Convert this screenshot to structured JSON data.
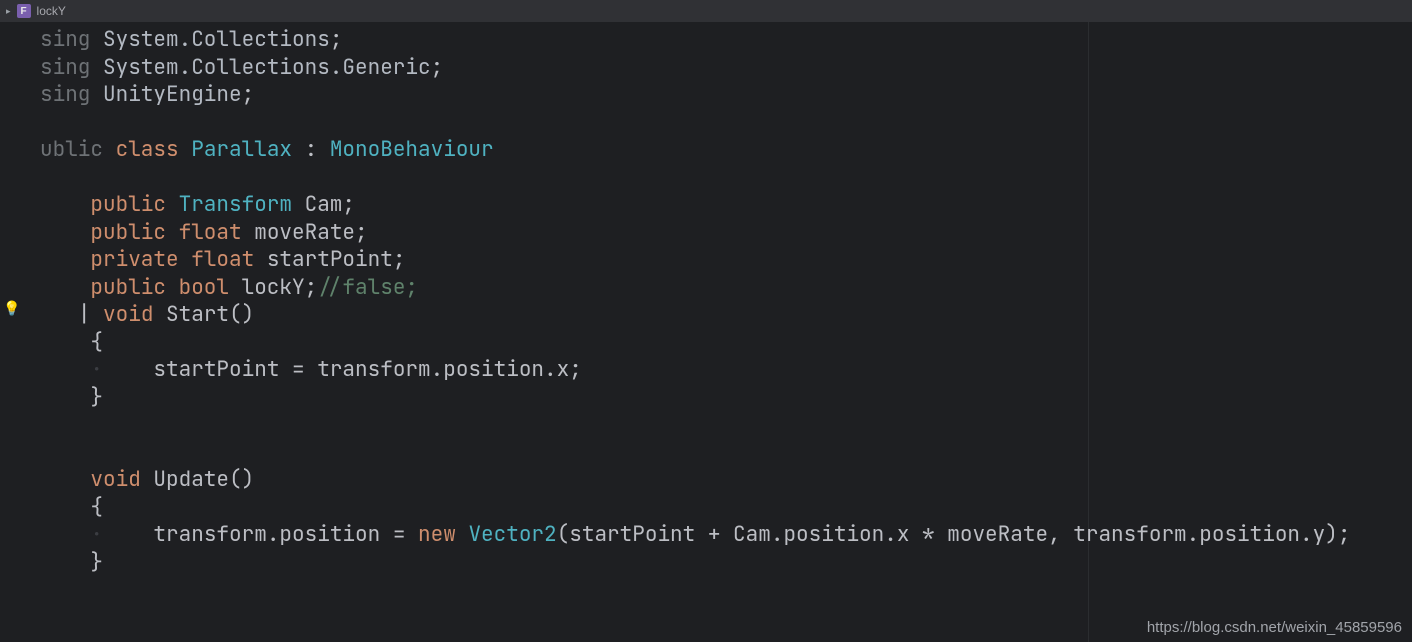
{
  "breadcrumb": {
    "expand": "▸",
    "badge": "F",
    "label": "lockY"
  },
  "code": {
    "l1": {
      "kw": "sing ",
      "ns": "System.Collections",
      "semi": ";"
    },
    "l2": {
      "kw": "sing ",
      "ns": "System.Collections.Generic",
      "semi": ";"
    },
    "l3": {
      "kw": "sing ",
      "ns": "UnityEngine",
      "semi": ";"
    },
    "l5a": "ublic ",
    "l5b": "class ",
    "l5c": "Parallax ",
    "l5d": ": ",
    "l5e": "MonoBehaviour",
    "l7a": "public ",
    "l7b": "Transform ",
    "l7c": "Cam",
    "l7d": ";",
    "l8a": "public ",
    "l8b": "float ",
    "l8c": "moveRate",
    "l8d": ";",
    "l9a": "private ",
    "l9b": "float ",
    "l9c": "startPoint",
    "l9d": ";",
    "l10a": "public ",
    "l10b": "bool ",
    "l10c": "lockY",
    "l10d": ";",
    "l10e": "//false;",
    "l11a": "void ",
    "l11b": "Start",
    "l11c": "()",
    "l12": "{",
    "l13": "startPoint = transform.position.x;",
    "l14": "}",
    "l17a": "void ",
    "l17b": "Update",
    "l17c": "()",
    "l18": "{",
    "l19a": "transform.position = ",
    "l19b": "new ",
    "l19c": "Vector2",
    "l19d": "(startPoint + Cam.position.x * moveRate, transform.position.y);",
    "l20": "}"
  },
  "bulb": "💡",
  "watermark": "https://blog.csdn.net/weixin_45859596"
}
